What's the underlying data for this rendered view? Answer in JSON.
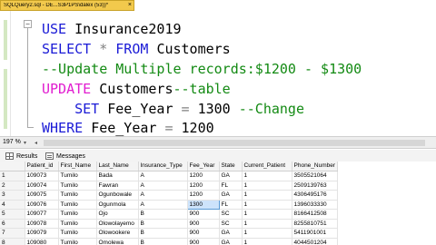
{
  "editor_tab": {
    "title": "SQLQuery2.sql - DE...S3P1PS\\dalex (53))*",
    "close_glyph": "×"
  },
  "code": {
    "lines": [
      {
        "parts": [
          {
            "t": "USE ",
            "c": "kw-blue"
          },
          {
            "t": "Insurance2019",
            "c": "pln"
          }
        ]
      },
      {
        "parts": [
          {
            "t": "SELECT ",
            "c": "kw-blue"
          },
          {
            "t": "* ",
            "c": "grey"
          },
          {
            "t": "FROM ",
            "c": "kw-blue"
          },
          {
            "t": "Customers",
            "c": "pln"
          }
        ]
      },
      {
        "parts": [
          {
            "t": "--Update Multiple records:$1200 - $1300",
            "c": "cmt"
          }
        ]
      },
      {
        "parts": [
          {
            "t": "UPDATE ",
            "c": "kw-pink"
          },
          {
            "t": "Customers",
            "c": "pln"
          },
          {
            "t": "--table",
            "c": "cmt"
          }
        ]
      },
      {
        "parts": [
          {
            "t": "    SET ",
            "c": "kw-blue"
          },
          {
            "t": "Fee_Year ",
            "c": "pln"
          },
          {
            "t": "= ",
            "c": "grey"
          },
          {
            "t": "1300 ",
            "c": "pln"
          },
          {
            "t": "--Change",
            "c": "cmt"
          }
        ]
      },
      {
        "parts": [
          {
            "t": "WHERE ",
            "c": "kw-blue"
          },
          {
            "t": "Fee_Year ",
            "c": "pln"
          },
          {
            "t": "= ",
            "c": "grey"
          },
          {
            "t": "1200",
            "c": "pln"
          }
        ]
      }
    ]
  },
  "zoom": {
    "level": "197 %",
    "arrow": "▾",
    "scroll_left": "◂"
  },
  "result_tabs": {
    "results_label": "Results",
    "messages_label": "Messages"
  },
  "results": {
    "columns": [
      "",
      "Patient_id",
      "First_Name",
      "Last_Name",
      "Insurance_Type",
      "Fee_Year",
      "State",
      "Current_Patient",
      "Phone_Number"
    ],
    "rows": [
      [
        "1",
        "109073",
        "Tumilo",
        "Bada",
        "A",
        "1200",
        "GA",
        "1",
        "3505521064"
      ],
      [
        "2",
        "109074",
        "Tumilo",
        "Fawran",
        "A",
        "1200",
        "FL",
        "1",
        "2509139763"
      ],
      [
        "3",
        "109075",
        "Tumilo",
        "Ogunbowale",
        "A",
        "1200",
        "GA",
        "1",
        "4306495176"
      ],
      [
        "4",
        "109076",
        "Tumilo",
        "Ogunmola",
        "A",
        "1300",
        "FL",
        "1",
        "1396033330"
      ],
      [
        "5",
        "109077",
        "Tumilo",
        "Ojo",
        "B",
        "900",
        "SC",
        "1",
        "8166412508"
      ],
      [
        "6",
        "109078",
        "Tumilo",
        "Olowolayemo",
        "B",
        "900",
        "SC",
        "1",
        "8255810751"
      ],
      [
        "7",
        "109079",
        "Tumilo",
        "Olowookere",
        "B",
        "900",
        "GA",
        "1",
        "5411901001"
      ],
      [
        "8",
        "109080",
        "Tumilo",
        "Omolewa",
        "B",
        "900",
        "GA",
        "1",
        "4044501204"
      ]
    ]
  }
}
